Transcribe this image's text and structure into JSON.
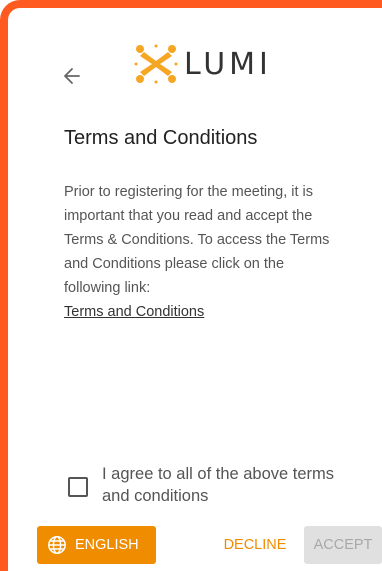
{
  "header": {
    "back_icon": "arrow-left-icon",
    "logo_text": "LUMI"
  },
  "page": {
    "title": "Terms and Conditions",
    "body_lines": [
      "Prior to registering for the meeting, it is",
      "important that you read and accept the",
      "Terms & Conditions. To access the Terms",
      "and Conditions please click on the",
      "following link:"
    ],
    "link_text": "Terms and Conditions"
  },
  "agreement": {
    "checked": false,
    "label_lines": [
      "I agree to all of the above terms",
      "and conditions"
    ]
  },
  "footer": {
    "language_label": "ENGLISH",
    "language_icon": "globe-icon",
    "decline_label": "DECLINE",
    "accept_label": "ACCEPT",
    "accept_enabled": false
  },
  "colors": {
    "frame": "#ff5a1f",
    "accent": "#f08c00",
    "logo_mark": "#f5a623",
    "disabled_bg": "#e0e0e0",
    "disabled_text": "#a8a8a8"
  }
}
